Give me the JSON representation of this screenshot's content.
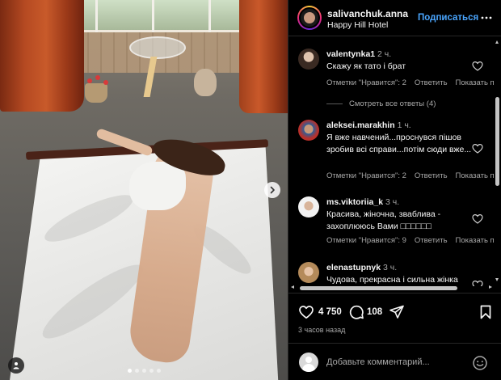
{
  "header": {
    "username": "salivanchuk.anna",
    "location": "Happy Hill Hotel",
    "follow_label": "Подписаться",
    "more_icon": "more-horizontal-icon"
  },
  "comments": [
    {
      "username": "valentynka1",
      "time": "2 ч.",
      "text": "Скажу як тато і брат",
      "likes_label": "Отметки \"Нравится\": 2",
      "reply_label": "Ответить",
      "translate_label": "Показать п",
      "view_replies": "Смотреть все ответы (4)"
    },
    {
      "username": "aleksei.marakhin",
      "time": "1 ч.",
      "text": "Я вже навчений...проснувся пішов зробив всі справи...потім сюди вже...",
      "likes_label": "Отметки \"Нравится\": 2",
      "reply_label": "Ответить",
      "translate_label": "Показать п"
    },
    {
      "username": "ms.viktoriia_k",
      "time": "3 ч.",
      "text": "Красива, жіночна, зваблива - захоплююсь Вами □□□□□□",
      "likes_label": "Отметки \"Нравится\": 9",
      "reply_label": "Ответить",
      "translate_label": "Показать п"
    },
    {
      "username": "elenastupnyk",
      "time": "3 ч.",
      "text": "Чудова, прекрасна і сильна жінка"
    }
  ],
  "actions": {
    "likes_count": "4 750",
    "comments_count": "108",
    "time_ago": "3 часов назад"
  },
  "composer": {
    "placeholder": "Добавьте комментарий..."
  },
  "carousel": {
    "slide_count": 5,
    "active_index": 0
  },
  "colors": {
    "accent": "#4aa6ff",
    "muted": "#a8a8a8",
    "background": "#000000"
  }
}
